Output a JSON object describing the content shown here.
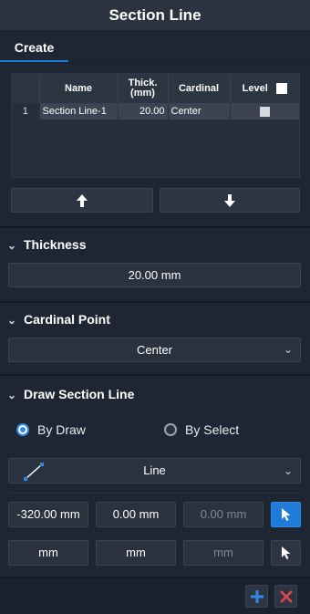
{
  "title": "Section Line",
  "tabs": [
    {
      "label": "Create"
    }
  ],
  "grid": {
    "columns": [
      "Name",
      "Thick.\n(mm)",
      "Cardinal",
      "Level"
    ],
    "rows": [
      {
        "index": "1",
        "name": "Section Line-1",
        "thick": "20.00",
        "cardinal": "Center"
      }
    ]
  },
  "icons": {
    "up": "arrow-up-icon",
    "down": "arrow-down-icon",
    "line": "line-icon",
    "pick": "cursor-icon",
    "add": "plus-icon",
    "delete": "close-icon"
  },
  "thickness": {
    "heading": "Thickness",
    "value": "20.00 mm"
  },
  "cardinal": {
    "heading": "Cardinal Point",
    "value": "Center"
  },
  "draw": {
    "heading": "Draw Section Line",
    "by_draw": "By Draw",
    "by_select": "By Select",
    "selected": "By Draw",
    "shape": "Line",
    "coords": [
      "-320.00 mm",
      "0.00 mm",
      "0.00 mm"
    ],
    "units": [
      "mm",
      "mm",
      "mm"
    ]
  },
  "colors": {
    "accent": "#1f7bd8",
    "add": "#2e8ae6",
    "delete": "#e04848"
  }
}
